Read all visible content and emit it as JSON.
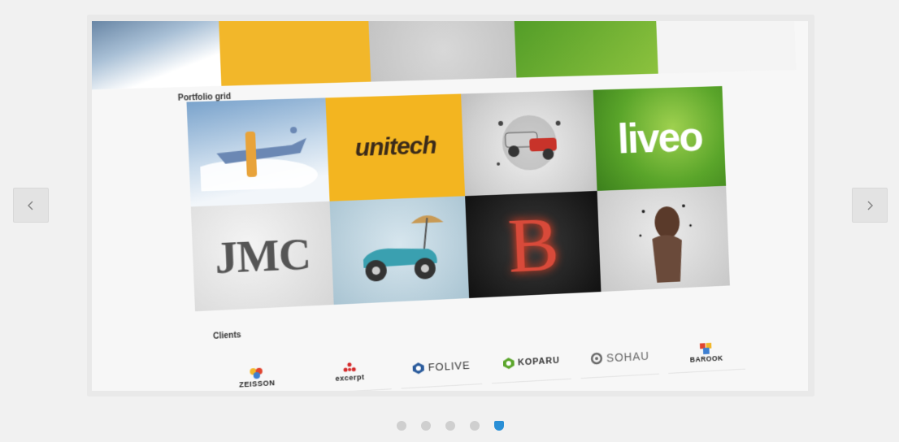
{
  "slider": {
    "portfolio_label": "Portfolio grid",
    "clients_label": "Clients",
    "grid_tiles": [
      {
        "name": "plane",
        "text": ""
      },
      {
        "name": "unitech",
        "text": "unitech"
      },
      {
        "name": "car-explosion",
        "text": ""
      },
      {
        "name": "liveo",
        "text": "liveo"
      },
      {
        "name": "jmc",
        "text": "JMC"
      },
      {
        "name": "buggy",
        "text": ""
      },
      {
        "name": "letter-b",
        "text": "B"
      },
      {
        "name": "woman",
        "text": ""
      }
    ],
    "clients": [
      {
        "label": "ZEISSON"
      },
      {
        "label": "excerpt"
      },
      {
        "label": "FOLIVE"
      },
      {
        "label": "KOPARU"
      },
      {
        "label": "SOHAU"
      },
      {
        "label": "BAROOK"
      }
    ]
  },
  "navigation": {
    "prev_icon": "chevron-left-icon",
    "next_icon": "chevron-right-icon"
  },
  "pagination": {
    "count": 5,
    "active_index": 4
  },
  "colors": {
    "accent": "#2a8fd6",
    "unitech_yellow": "#f3b520",
    "liveo_green": "#5aa52a"
  }
}
